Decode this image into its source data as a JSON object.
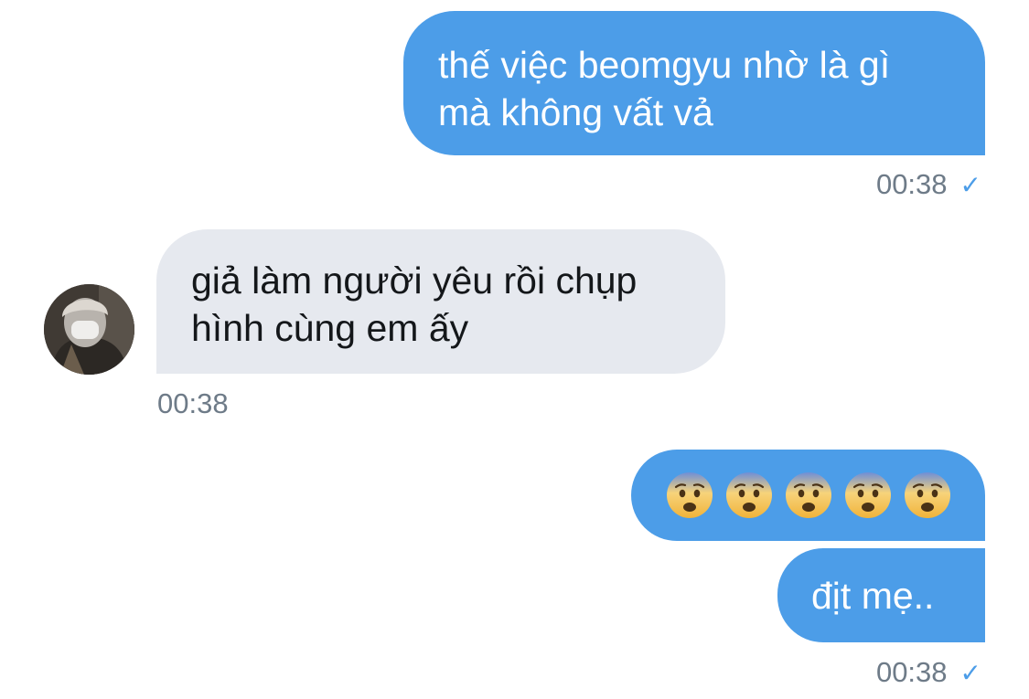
{
  "messages": [
    {
      "direction": "outgoing",
      "text": "thế việc beomgyu nhờ là gì\nmà không vất vả"
    },
    {
      "direction": "incoming",
      "text": "giả làm người yêu rồi chụp\nhình cùng em ấy"
    },
    {
      "direction": "outgoing",
      "emoji": [
        "anxious-face-icon",
        "anxious-face-icon",
        "anxious-face-icon",
        "anxious-face-icon",
        "anxious-face-icon"
      ]
    },
    {
      "direction": "outgoing",
      "text": "địt mẹ.."
    }
  ],
  "timestamps": {
    "first": "00:38",
    "second": "00:38",
    "third": "00:38"
  },
  "read_receipt": "✓",
  "colors": {
    "outgoing_bubble": "#4c9de8",
    "incoming_bubble": "#e6e9ef",
    "timestamp": "#6e7b88"
  }
}
